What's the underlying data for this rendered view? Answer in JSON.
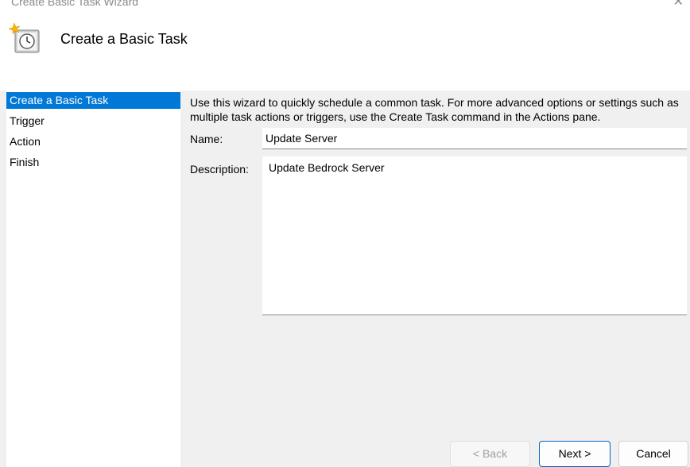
{
  "window": {
    "title": "Create Basic Task Wizard",
    "close_label": "✕"
  },
  "header": {
    "title": "Create a Basic Task",
    "icon": "clock-task-icon"
  },
  "steps": [
    {
      "label": "Create a Basic Task",
      "active": true
    },
    {
      "label": "Trigger",
      "active": false
    },
    {
      "label": "Action",
      "active": false
    },
    {
      "label": "Finish",
      "active": false
    }
  ],
  "main": {
    "intro": "Use this wizard to quickly schedule a common task.  For more advanced options or settings such as multiple task actions or triggers, use the Create Task command in the Actions pane.",
    "name_label": "Name:",
    "name_value": "Update Server",
    "description_label": "Description:",
    "description_value": "Update Bedrock Server"
  },
  "buttons": {
    "back": "< Back",
    "next": "Next >",
    "cancel": "Cancel"
  },
  "colors": {
    "accent": "#0078d7",
    "background": "#f0f0f0"
  }
}
